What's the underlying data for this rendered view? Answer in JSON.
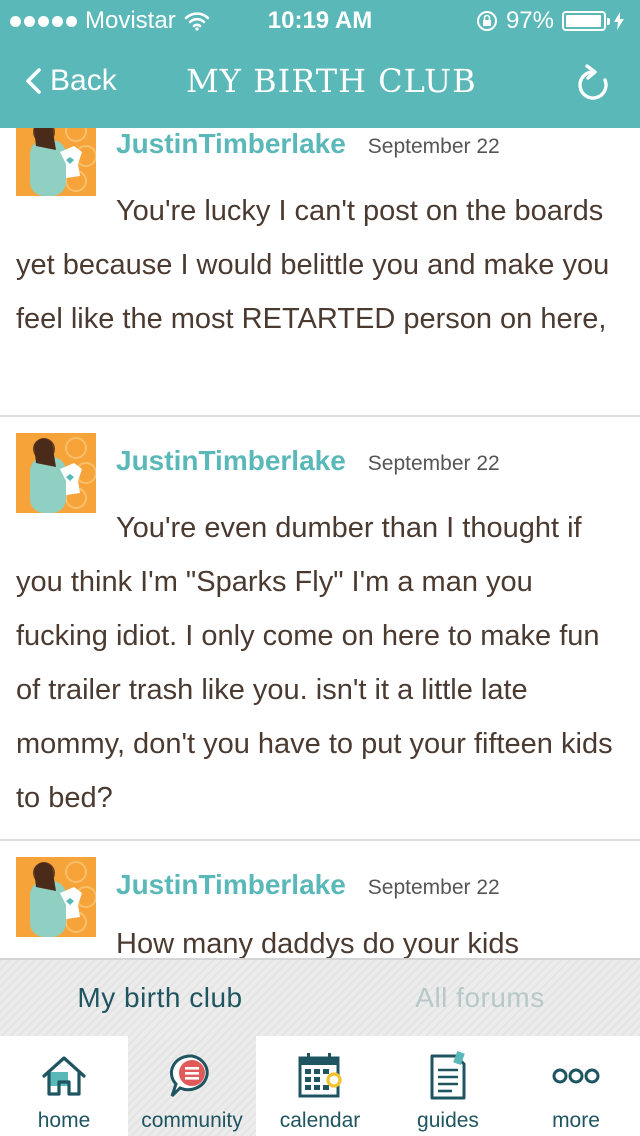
{
  "status_bar": {
    "carrier": "Movistar",
    "time": "10:19 AM",
    "battery": "97%",
    "battery_level": 0.97
  },
  "nav": {
    "back_label": "Back",
    "title": "MY BIRTH CLUB"
  },
  "posts": [
    {
      "author": "JustinTimberlake",
      "date": "September 22",
      "text": "You're lucky I can't post on the boards yet because I would belittle you and make you feel like the most RETARTED person on here,"
    },
    {
      "author": "JustinTimberlake",
      "date": "September 22",
      "text": "You're even dumber than I thought if you think I'm \"Sparks Fly\" I'm a man you fucking idiot. I only come on here to make fun of trailer trash like you. isn't it a little late mommy, don't you have to put your fifteen kids to bed?"
    },
    {
      "author": "JustinTimberlake",
      "date": "September 22",
      "text": "How many daddys do your kids"
    }
  ],
  "board_tabs": {
    "my_birth_club": "My birth club",
    "all_forums": "All forums"
  },
  "tab_bar": {
    "home": "home",
    "community": "community",
    "calendar": "calendar",
    "guides": "guides",
    "more": "more"
  },
  "colors": {
    "brand_teal": "#5bb8b9",
    "dark_teal": "#1f5560",
    "post_text": "#4a3a30",
    "avatar_bg": "#f6a33a",
    "community_red": "#e05a5a",
    "calendar_yellow": "#f2c22e"
  }
}
